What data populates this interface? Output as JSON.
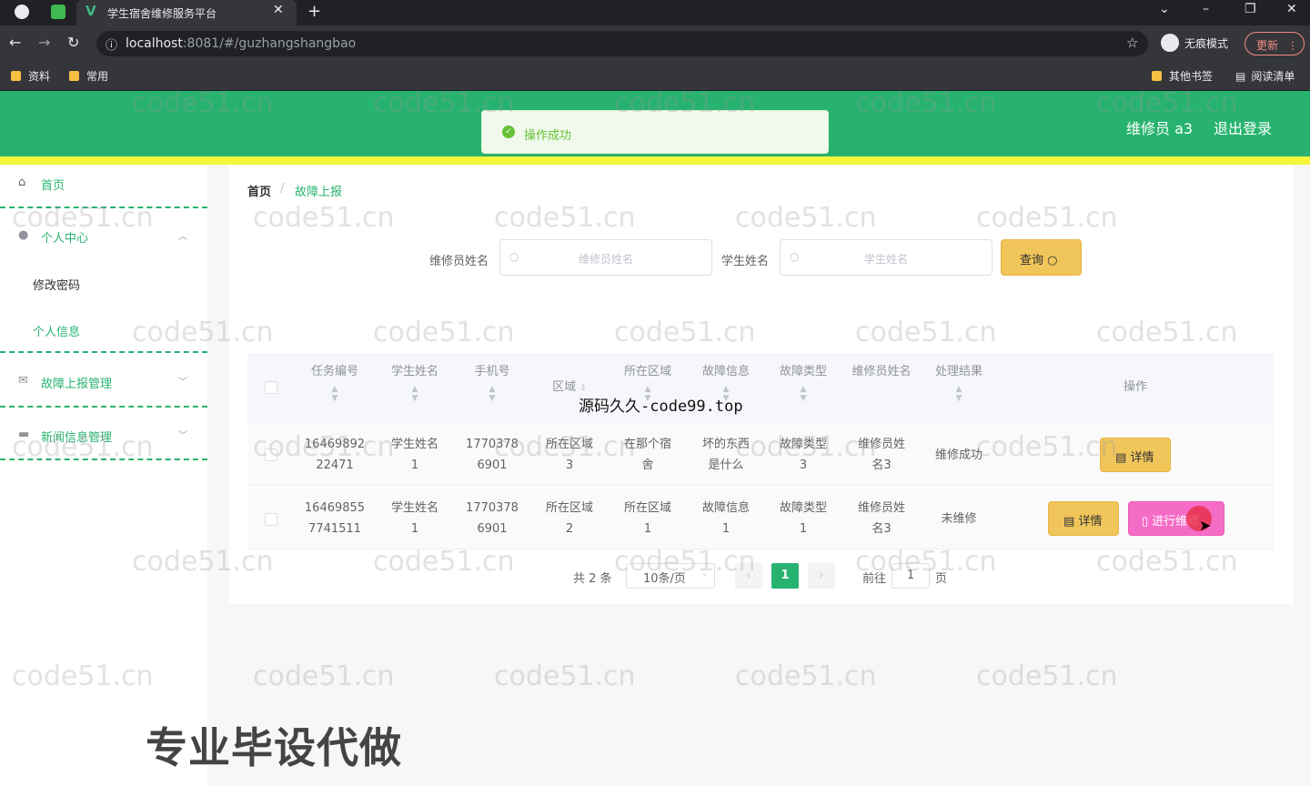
{
  "browser": {
    "tab_title": "学生宿舍维修服务平台",
    "url_host": "localhost",
    "url_rest": ":8081/#/guzhangshangbao",
    "incognito_label": "无痕模式",
    "update_label": "更新",
    "bookmarks": [
      "资料",
      "常用",
      "其他书签",
      "阅读清单"
    ]
  },
  "header": {
    "user": "维修员 a3",
    "logout": "退出登录",
    "toast": "操作成功"
  },
  "sidebar": {
    "home": "首页",
    "personal": "个人中心",
    "change_password": "修改密码",
    "personal_info": "个人信息",
    "fault_mgmt": "故障上报管理",
    "news_mgmt": "新闻信息管理"
  },
  "breadcrumb": {
    "home": "首页",
    "sep": "/",
    "current": "故障上报"
  },
  "search": {
    "repairman_label": "维修员姓名",
    "repairman_placeholder": "维修员姓名",
    "student_label": "学生姓名",
    "student_placeholder": "学生姓名",
    "query_label": "查询"
  },
  "table": {
    "columns": [
      "任务编号",
      "学生姓名",
      "手机号",
      "区域",
      "所在区域",
      "故障信息",
      "故障类型",
      "维修员姓名",
      "处理结果",
      "操作"
    ],
    "rows": [
      {
        "id_1": "16469892",
        "id_2": "22471",
        "student_1": "学生姓名",
        "student_2": "1",
        "phone_1": "1770378",
        "phone_2": "6901",
        "area_1": "所在区域",
        "area_2": "3",
        "location_1": "在那个宿",
        "location_2": "舍",
        "fault_1": "坏的东西",
        "fault_2": "是什么",
        "type_1": "故障类型",
        "type_2": "3",
        "repairman_1": "维修员姓",
        "repairman_2": "名3",
        "result": "维修成功"
      },
      {
        "id_1": "16469855",
        "id_2": "7741511",
        "student_1": "学生姓名",
        "student_2": "1",
        "phone_1": "1770378",
        "phone_2": "6901",
        "area_1": "所在区域",
        "area_2": "2",
        "location_1": "所在区域",
        "location_2": "1",
        "fault_1": "故障信息",
        "fault_2": "1",
        "type_1": "故障类型",
        "type_2": "1",
        "repairman_1": "维修员姓",
        "repairman_2": "名3",
        "result": "未维修"
      }
    ],
    "detail_label": "详情",
    "fix_label": "进行维修"
  },
  "pagination": {
    "total": "共 2 条",
    "page_size": "10条/页",
    "current": "1",
    "goto_label": "前往",
    "goto_value": "1",
    "page_unit": "页"
  },
  "overlay": {
    "source_text": "源码久久-code99.top",
    "promo": "专业毕设代做",
    "watermark": "code51.cn"
  },
  "colors": {
    "primary": "#27b36f",
    "warning": "#f0c55a",
    "pink": "#f56cc6",
    "yellow_bar": "#f5f53b"
  }
}
